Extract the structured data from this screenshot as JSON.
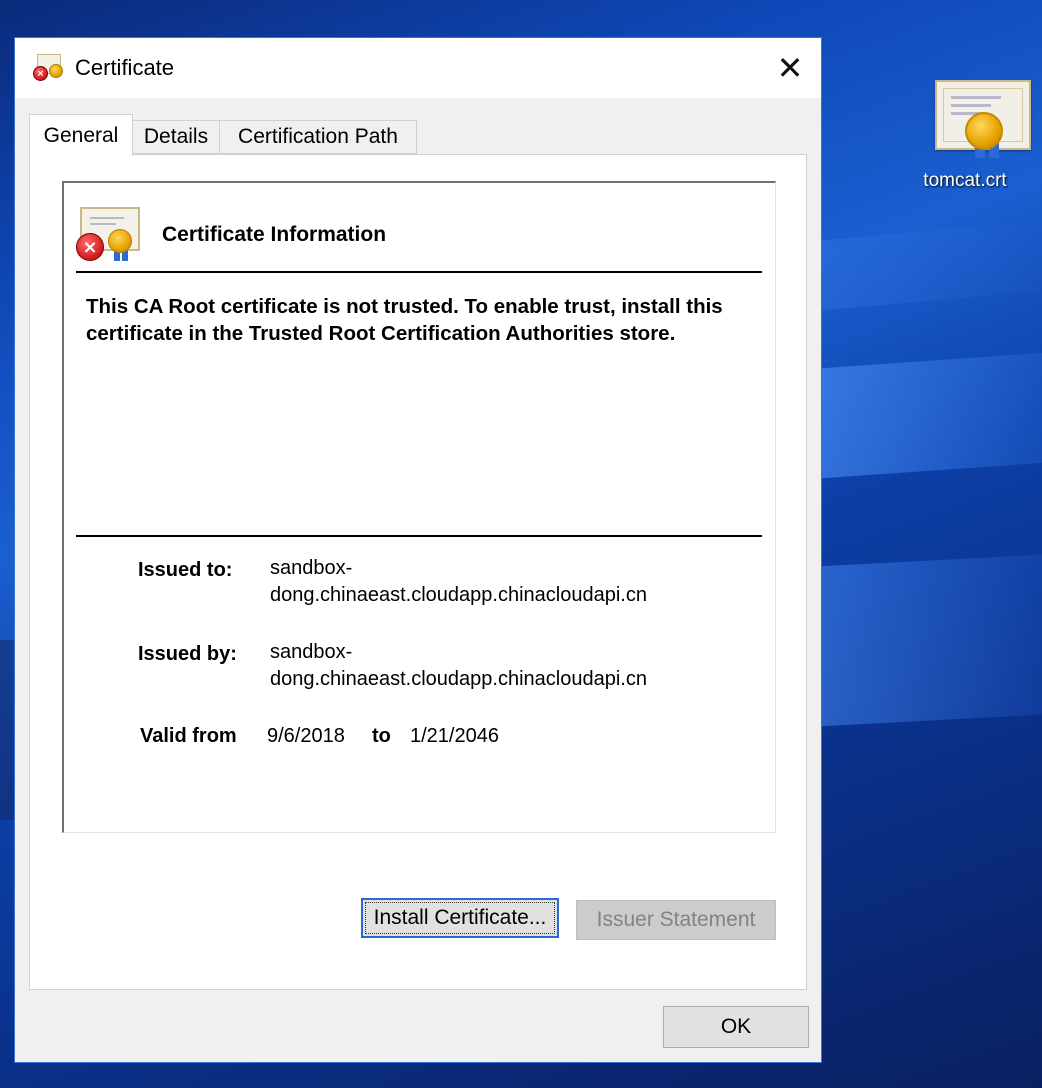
{
  "desktop": {
    "icon_label": "tomcat.crt",
    "icon_name": "certificate-file-icon"
  },
  "dialog": {
    "title": "Certificate",
    "close_glyph": "✕",
    "tabs": [
      {
        "label": "General",
        "active": true
      },
      {
        "label": "Details",
        "active": false
      },
      {
        "label": "Certification Path",
        "active": false
      }
    ],
    "info": {
      "heading": "Certificate Information",
      "warning": "This CA Root certificate is not trusted. To enable trust, install this certificate in the Trusted Root Certification Authorities store.",
      "issued_to_label": "Issued to:",
      "issued_to_value": "sandbox-dong.chinaeast.cloudapp.chinacloudapi.cn",
      "issued_by_label": "Issued by:",
      "issued_by_value": "sandbox-dong.chinaeast.cloudapp.chinacloudapi.cn",
      "valid_from_label": "Valid from",
      "valid_from_value": "9/6/2018",
      "valid_to_label": "to",
      "valid_to_value": "1/21/2046"
    },
    "buttons": {
      "install": "Install Certificate...",
      "issuer_statement": "Issuer Statement",
      "ok": "OK"
    }
  },
  "colors": {
    "focus_border": "#2a6ad8",
    "error_red": "#d11919",
    "seal_gold": "#e6a200"
  }
}
